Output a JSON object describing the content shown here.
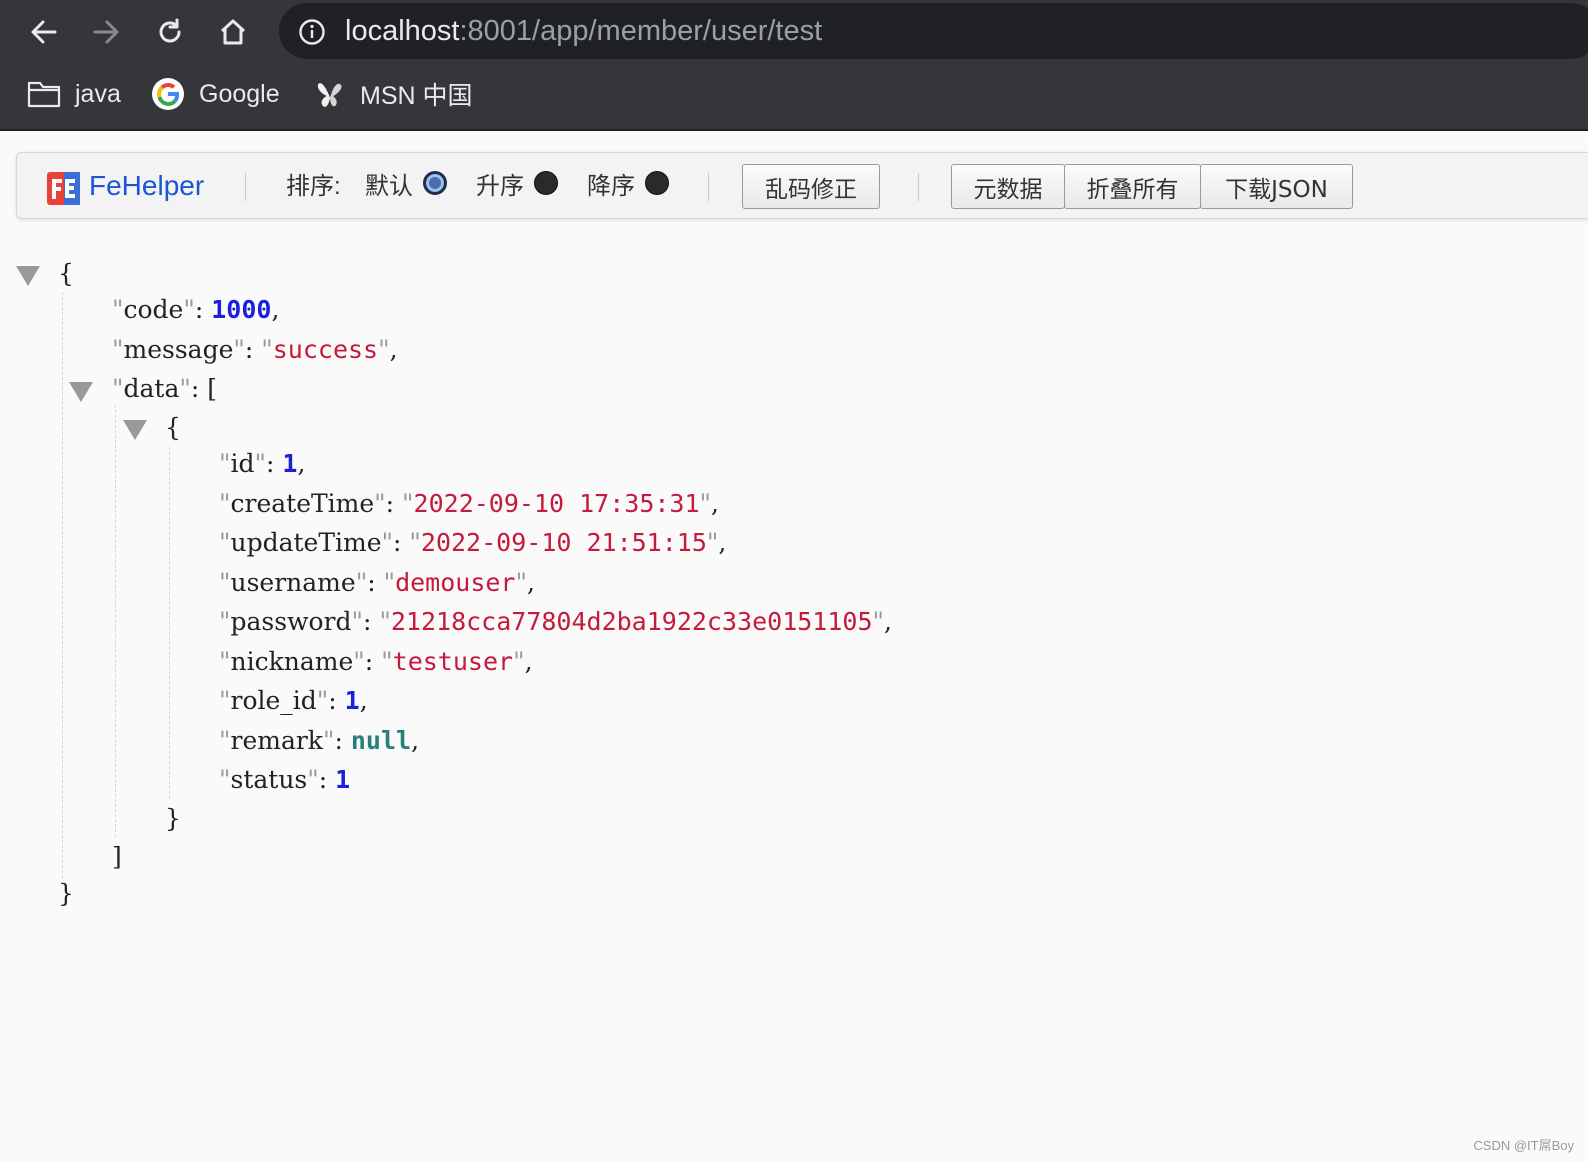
{
  "browser": {
    "url_host": "localhost",
    "url_path": ":8001/app/member/user/test",
    "bookmarks": [
      "java",
      "Google",
      "MSN 中国"
    ]
  },
  "fehelper": {
    "title": "FeHelper",
    "sort_label": "排序:",
    "sort_default": "默认",
    "sort_asc": "升序",
    "sort_desc": "降序",
    "sort_selected": "默认",
    "fix_encoding_button": "乱码修正",
    "metadata_button": "元数据",
    "collapse_all_button": "折叠所有",
    "download_json_button": "下载JSON"
  },
  "json": {
    "code_key": "code",
    "code_value": "1000",
    "message_key": "message",
    "message_value": "success",
    "data_key": "data",
    "record": {
      "id_key": "id",
      "id_value": "1",
      "createTime_key": "createTime",
      "createTime_value": "2022-09-10 17:35:31",
      "updateTime_key": "updateTime",
      "updateTime_value": "2022-09-10 21:51:15",
      "username_key": "username",
      "username_value": "demouser",
      "password_key": "password",
      "password_value": "21218cca77804d2ba1922c33e0151105",
      "nickname_key": "nickname",
      "nickname_value": "testuser",
      "role_id_key": "role_id",
      "role_id_value": "1",
      "remark_key": "remark",
      "remark_value": "null",
      "status_key": "status",
      "status_value": "1"
    }
  },
  "watermark": "CSDN @IT屌Boy"
}
